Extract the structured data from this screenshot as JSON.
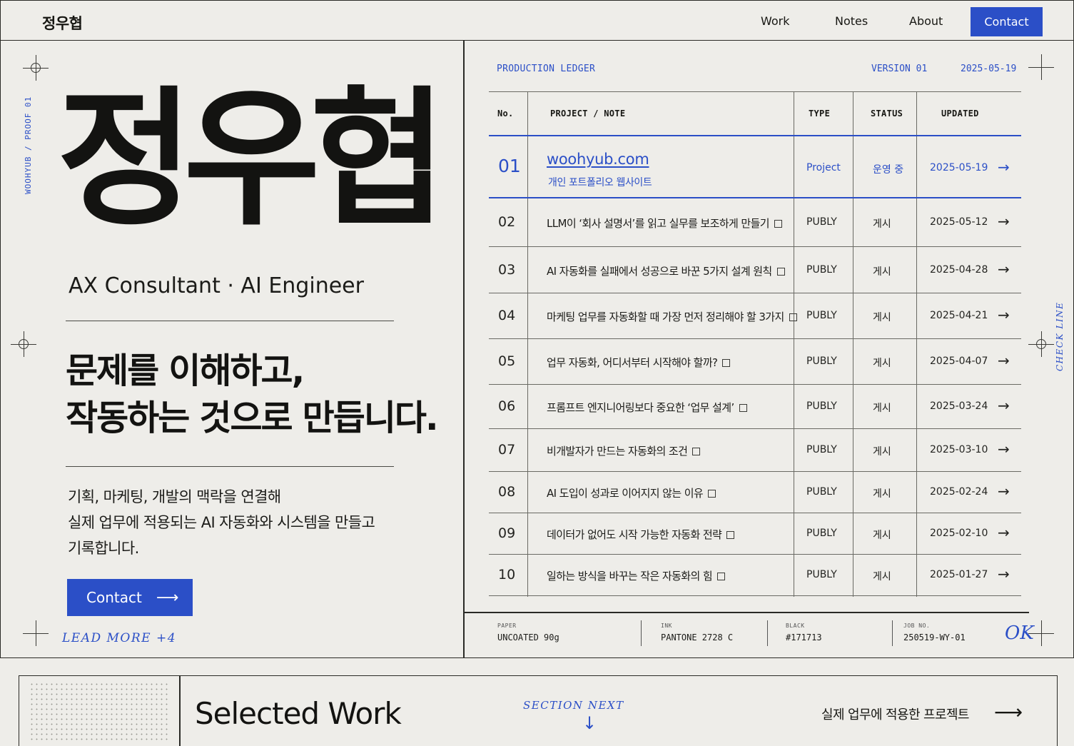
{
  "header": {
    "brand": "정우협",
    "nav": [
      "Work",
      "Notes",
      "About"
    ],
    "contact": "Contact"
  },
  "hero": {
    "side_label": "WOOHYUB / PROOF 01",
    "name": "정우협",
    "role": "AX Consultant · AI Engineer",
    "headline_1": "문제를 이해하고,",
    "headline_2": "작동하는 것으로 만듭니다.",
    "intro_1": "기획, 마케팅, 개발의 맥락을 연결해",
    "intro_2": "실제 업무에 적용되는 AI 자동화와 시스템을 만들고",
    "intro_3": "기록합니다.",
    "contact": "Contact",
    "contact_arrow": "⟶",
    "lead_more": "LEAD MORE +4"
  },
  "ledger": {
    "title": "PRODUCTION LEDGER",
    "version": "VERSION 01",
    "date": "2025-05-19",
    "columns": [
      "No.",
      "PROJECT / NOTE",
      "TYPE",
      "STATUS",
      "UPDATED"
    ],
    "featured": {
      "no": "01",
      "title": "woohyub.com",
      "subtitle": "개인 포트폴리오 웹사이트",
      "type": "Project",
      "status": "운영 중",
      "updated": "2025-05-19",
      "arrow": "→"
    },
    "rows": [
      {
        "no": "02",
        "title": "LLM이 ‘회사 설명서’를 읽고 실무를 보조하게 만들기",
        "type": "PUBLY",
        "status": "게시",
        "updated": "2025-05-12",
        "arrow": "→"
      },
      {
        "no": "03",
        "title": "AI 자동화를 실패에서 성공으로 바꾼 5가지 설계 원칙",
        "type": "PUBLY",
        "status": "게시",
        "updated": "2025-04-28",
        "arrow": "→"
      },
      {
        "no": "04",
        "title": "마케팅 업무를 자동화할 때 가장 먼저 정리해야 할 3가지",
        "type": "PUBLY",
        "status": "게시",
        "updated": "2025-04-21",
        "arrow": "→"
      },
      {
        "no": "05",
        "title": "업무 자동화, 어디서부터 시작해야 할까?",
        "type": "PUBLY",
        "status": "게시",
        "updated": "2025-04-07",
        "arrow": "→"
      },
      {
        "no": "06",
        "title": "프롬프트 엔지니어링보다 중요한 ‘업무 설계’",
        "type": "PUBLY",
        "status": "게시",
        "updated": "2025-03-24",
        "arrow": "→"
      },
      {
        "no": "07",
        "title": "비개발자가 만드는 자동화의 조건",
        "type": "PUBLY",
        "status": "게시",
        "updated": "2025-03-10",
        "arrow": "→"
      },
      {
        "no": "08",
        "title": "AI 도입이 성과로 이어지지 않는 이유",
        "type": "PUBLY",
        "status": "게시",
        "updated": "2025-02-24",
        "arrow": "→"
      },
      {
        "no": "09",
        "title": "데이터가 없어도 시작 가능한 자동화 전략",
        "type": "PUBLY",
        "status": "게시",
        "updated": "2025-02-10",
        "arrow": "→"
      },
      {
        "no": "10",
        "title": "일하는 방식을 바꾸는 작은 자동화의 힘",
        "type": "PUBLY",
        "status": "게시",
        "updated": "2025-01-27",
        "arrow": "→"
      }
    ]
  },
  "specs": [
    {
      "k": "PAPER",
      "v": "UNCOATED 90g"
    },
    {
      "k": "INK",
      "v": "PANTONE 2728 C"
    },
    {
      "k": "BLACK",
      "v": "#171713"
    },
    {
      "k": "JOB NO.",
      "v": "250519-WY-01"
    }
  ],
  "ok_mark": "OK",
  "check_line": "CHECK LINE",
  "bottom": {
    "title": "Selected Work",
    "section_next": "SECTION NEXT",
    "section_arrow": "↓",
    "desc": "실제 업무에 적용한 프로젝트",
    "arrow": "⟶"
  },
  "colors": {
    "accent": "#2b4fc7",
    "ink": "#171713",
    "paper": "#eeede9"
  }
}
